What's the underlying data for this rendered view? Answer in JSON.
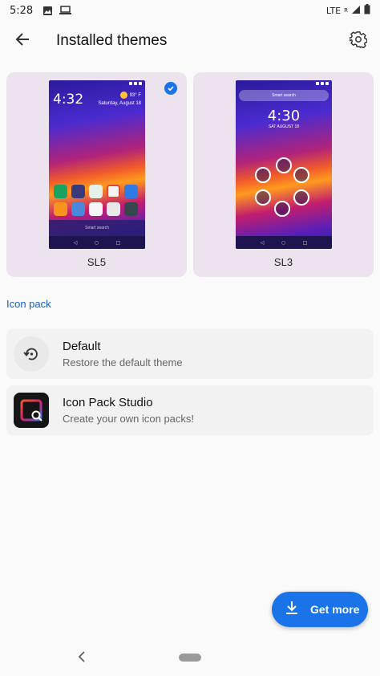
{
  "status_bar": {
    "time": "5:28",
    "network": "LTE",
    "network_sup": "R"
  },
  "app_bar": {
    "title": "Installed themes",
    "back_icon": "arrow-back-icon",
    "settings_icon": "gear-icon"
  },
  "themes": [
    {
      "name": "SL5",
      "selected": true,
      "preview": {
        "clock": "4:32",
        "temperature": "93° F",
        "date": "Saturday, August 18",
        "search": "Smart search"
      }
    },
    {
      "name": "SL3",
      "selected": false,
      "preview": {
        "search": "Smart search",
        "clock": "4:30",
        "date": "SAT AUGUST 18"
      }
    }
  ],
  "icon_pack": {
    "section_label": "Icon pack",
    "items": [
      {
        "title": "Default",
        "subtitle": "Restore the default theme",
        "icon": "restore-icon"
      },
      {
        "title": "Icon Pack Studio",
        "subtitle": "Create your own icon packs!",
        "icon": "icon-pack-studio-icon"
      }
    ]
  },
  "fab": {
    "label": "Get more",
    "icon": "download-icon"
  },
  "colors": {
    "accent": "#1a73e8",
    "card_bg": "#ede3ee",
    "section_label": "#1a5fc4"
  }
}
